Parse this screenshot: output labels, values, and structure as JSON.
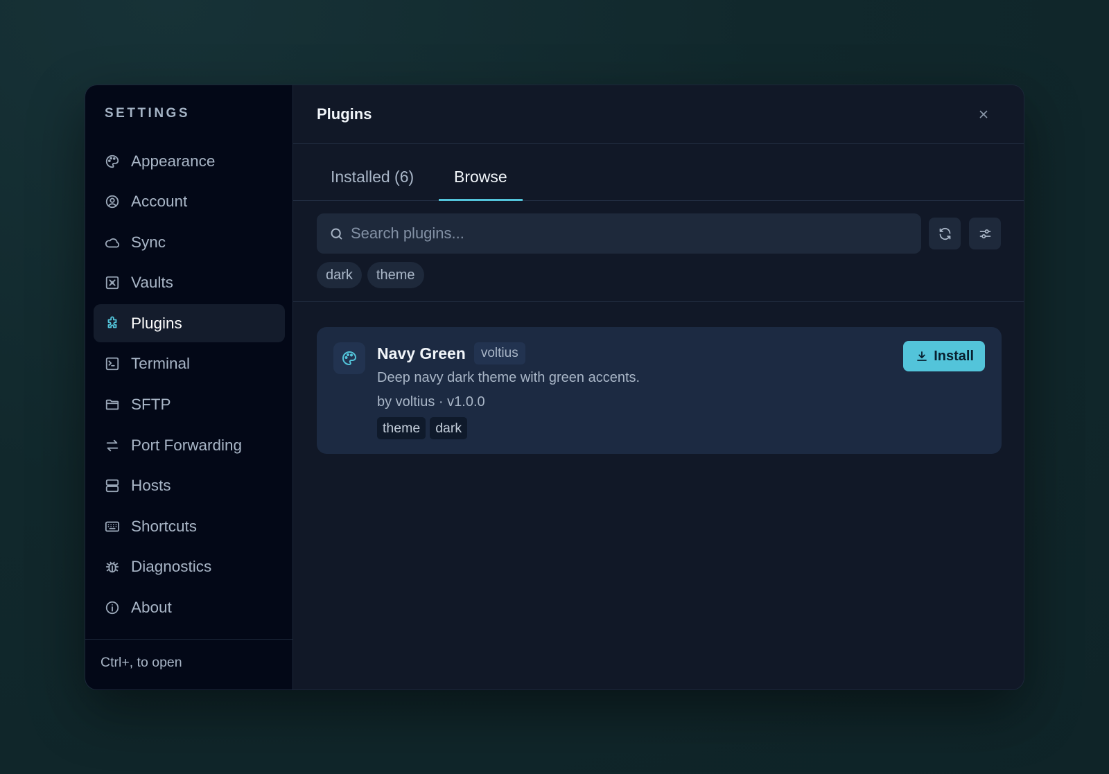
{
  "sidebar": {
    "title": "SETTINGS",
    "items": [
      {
        "label": "Appearance",
        "icon": "palette-icon"
      },
      {
        "label": "Account",
        "icon": "user-circle-icon"
      },
      {
        "label": "Sync",
        "icon": "cloud-icon"
      },
      {
        "label": "Vaults",
        "icon": "vault-icon"
      },
      {
        "label": "Plugins",
        "icon": "puzzle-icon",
        "active": true
      },
      {
        "label": "Terminal",
        "icon": "terminal-icon"
      },
      {
        "label": "SFTP",
        "icon": "folder-icon"
      },
      {
        "label": "Port Forwarding",
        "icon": "arrows-left-right-icon"
      },
      {
        "label": "Hosts",
        "icon": "server-icon"
      },
      {
        "label": "Shortcuts",
        "icon": "keyboard-icon"
      },
      {
        "label": "Diagnostics",
        "icon": "bug-icon"
      },
      {
        "label": "About",
        "icon": "info-icon"
      }
    ],
    "footer": "Ctrl+, to open"
  },
  "header": {
    "title": "Plugins",
    "close_icon": "close-icon"
  },
  "tabs": [
    {
      "label": "Installed (6)",
      "active": false
    },
    {
      "label": "Browse",
      "active": true
    }
  ],
  "search": {
    "placeholder": "Search plugins...",
    "value": ""
  },
  "filter_chips": [
    "dark",
    "theme"
  ],
  "plugins": [
    {
      "name": "Navy Green",
      "author_badge": "voltius",
      "description": "Deep navy dark theme with green accents.",
      "meta": "by voltius · v1.0.0",
      "tags": [
        "theme",
        "dark"
      ],
      "action_label": "Install",
      "icon": "palette-icon"
    }
  ],
  "colors": {
    "accent": "#53c4da",
    "sidebar_bg": "#030817",
    "main_bg": "#111827",
    "card_bg": "#1c2a42"
  }
}
